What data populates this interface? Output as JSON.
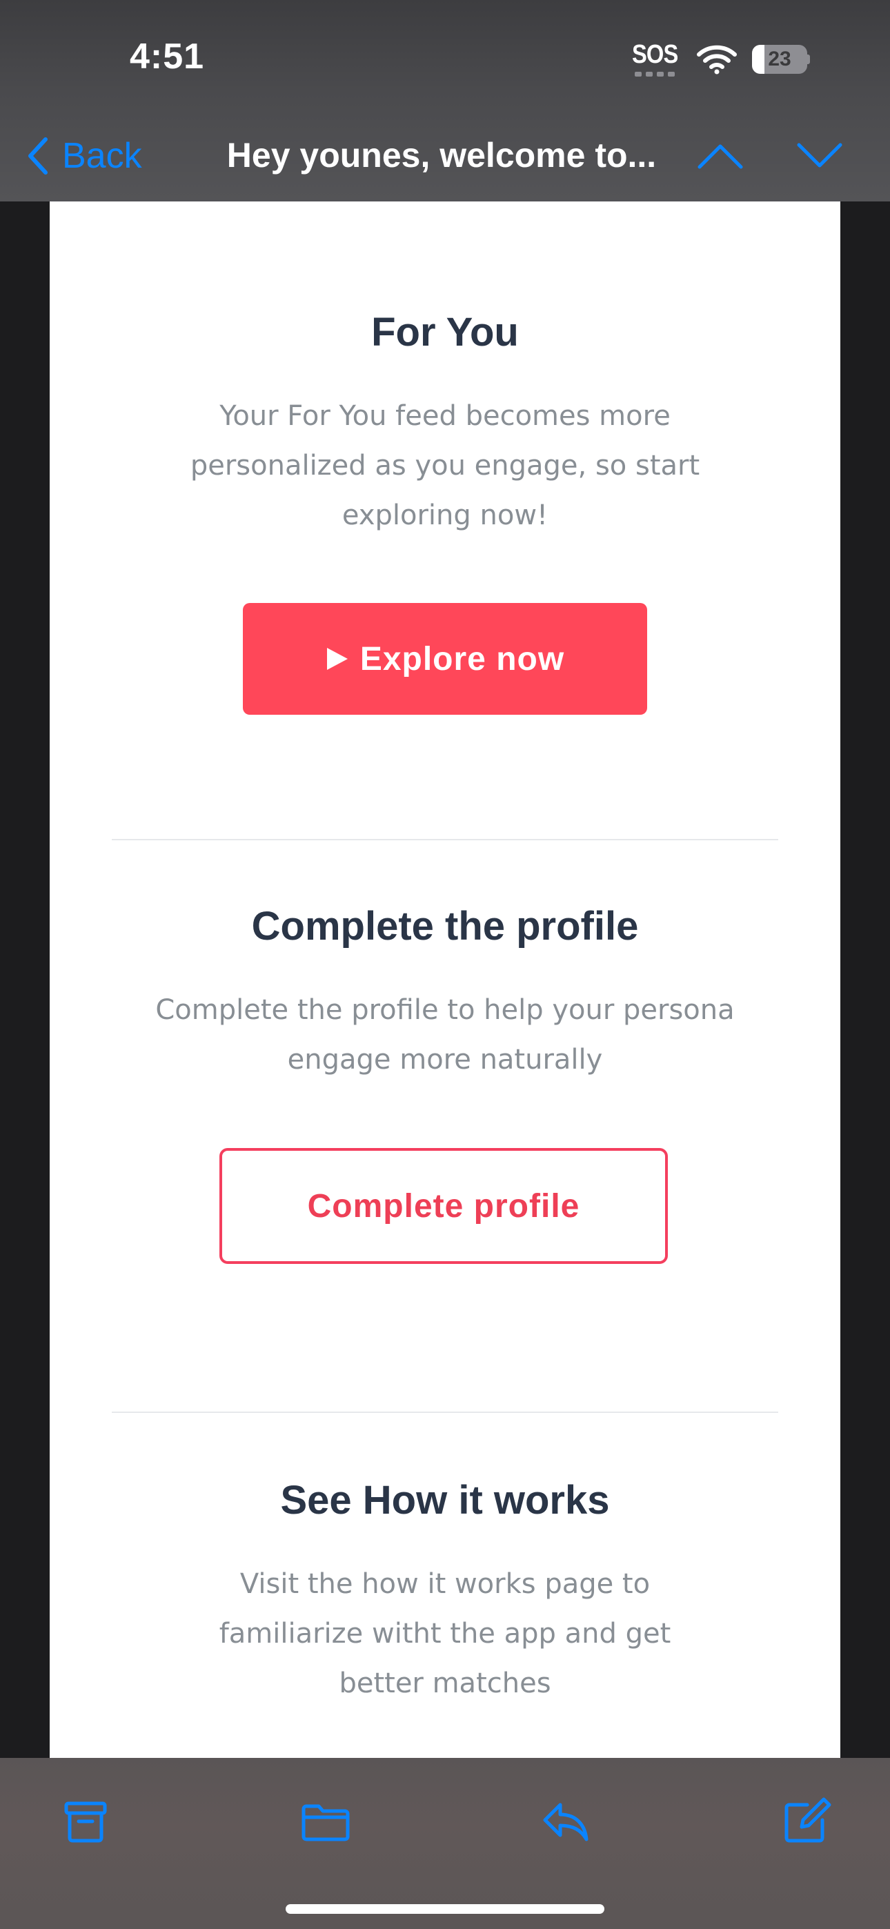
{
  "status_bar": {
    "time": "4:51",
    "sos_label": "SOS",
    "battery_level": "23"
  },
  "nav": {
    "back_label": "Back",
    "title": "Hey younes, welcome to..."
  },
  "email": {
    "for_you": {
      "title": "For You",
      "text": "Your For You feed becomes more personalized as you engage, so start exploring now!",
      "button_label": "Explore now"
    },
    "complete_profile": {
      "title": "Complete the profile",
      "text": "Complete the profile to help your persona engage more naturally",
      "button_label": "Complete profile"
    },
    "how_it_works": {
      "title": "See How it works",
      "text": "Visit the how it works page to familiarize witht the app and get better matches"
    }
  },
  "toolbar": {
    "icons": [
      "archive-icon",
      "folder-icon",
      "reply-icon",
      "compose-icon"
    ]
  },
  "colors": {
    "accent": "#0a84ff",
    "brand": "#ff4759",
    "heading": "#2a3547",
    "body_text": "#888e94"
  }
}
